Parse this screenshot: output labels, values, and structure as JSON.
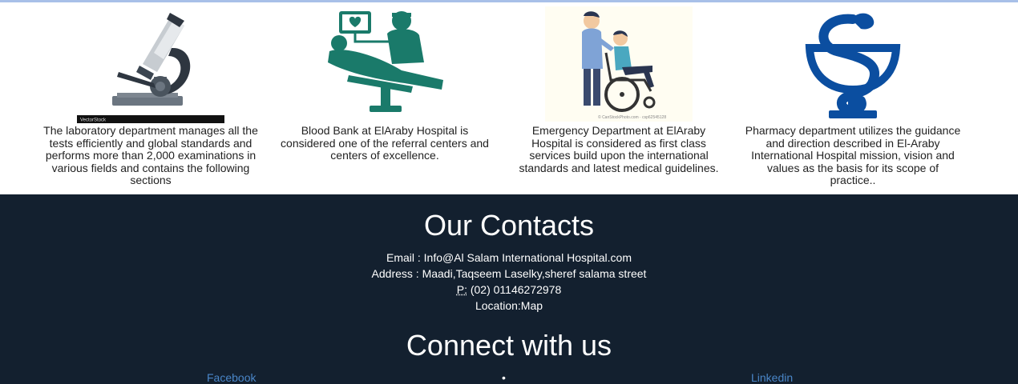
{
  "services": [
    {
      "name": "laboratory",
      "image": "microscope-image",
      "watermark": "VectorStock",
      "text": "The laboratory department manages all the tests efficiently and global standards and performs more than 2,000 examinations in various fields and contains the following sections"
    },
    {
      "name": "blood-bank",
      "image": "blood-donation-image",
      "text": "Blood Bank at ElAraby Hospital is considered one of the referral centers and centers of excellence."
    },
    {
      "name": "emergency",
      "image": "wheelchair-image",
      "watermark": "© CanStockPhoto.com · csp62545128",
      "text": "Emergency Department at ElAraby Hospital is considered as first class services build upon the international standards and latest medical guidelines."
    },
    {
      "name": "pharmacy",
      "image": "caduceus-image",
      "text": "Pharmacy department utilizes the guidance and direction described in El-Araby International Hospital mission, vision and values as the basis for its scope of practice.."
    }
  ],
  "contacts": {
    "title": "Our Contacts",
    "email": "Email : Info@Al Salam International Hospital.com",
    "address": "Address : Maadi,Taqseem Laselky,sheref salama street",
    "phone_label": "P:",
    "phone": " (02) 01146272978",
    "location": "Location:Map"
  },
  "connect": {
    "title": "Connect with us",
    "facebook": "Facebook",
    "bullet": "•",
    "linkedin": "Linkedin"
  },
  "colors": {
    "footer_bg": "#13202f",
    "link": "#4a86c8",
    "teal": "#1a7a6a",
    "navy": "#0b4ea0"
  }
}
